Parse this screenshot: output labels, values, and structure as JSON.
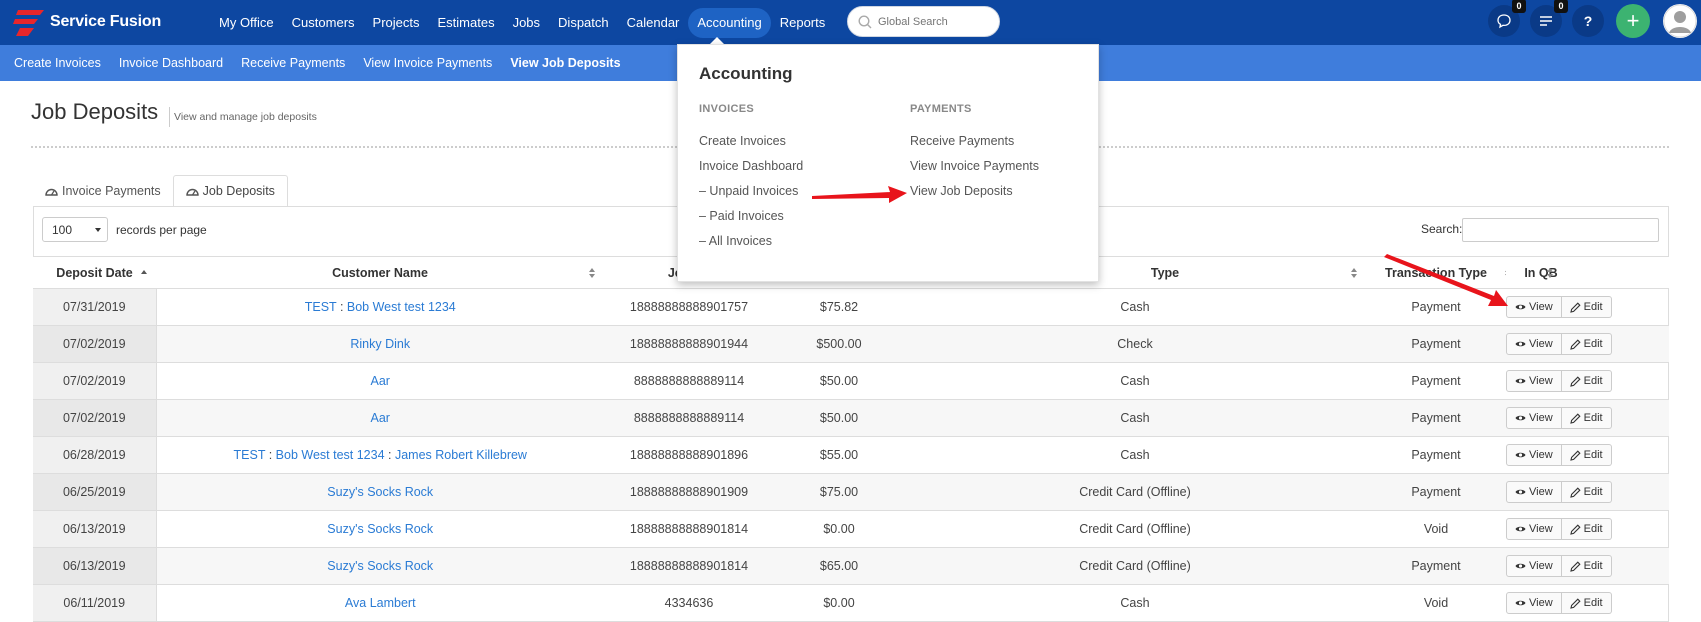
{
  "app": {
    "name": "Service Fusion"
  },
  "nav": {
    "items": [
      "My Office",
      "Customers",
      "Projects",
      "Estimates",
      "Jobs",
      "Dispatch",
      "Calendar",
      "Accounting",
      "Reports"
    ],
    "active": "Accounting",
    "search_placeholder": "Global Search",
    "chat_badge": "0",
    "tasks_badge": "0",
    "help_label": "?",
    "add_label": "+"
  },
  "subnav": {
    "items": [
      "Create Invoices",
      "Invoice Dashboard",
      "Receive Payments",
      "View Invoice Payments",
      "View Job Deposits"
    ],
    "active": "View Job Deposits"
  },
  "page": {
    "title": "Job Deposits",
    "subtitle": "View and manage job deposits"
  },
  "tabs": [
    "Invoice Payments",
    "Job Deposits"
  ],
  "active_tab": "Job Deposits",
  "table_controls": {
    "page_length": "100",
    "page_length_label": "records per page",
    "search_label": "Search:"
  },
  "table": {
    "headers": [
      "Deposit Date",
      "Customer Name",
      "Job Nu",
      "",
      "Type",
      "Transaction Type",
      "In QB",
      ""
    ],
    "view_label": "View",
    "edit_label": "Edit",
    "rows": [
      {
        "date": "07/31/2019",
        "customer_prefix": "TEST",
        "customer": "Bob West test 1234",
        "customer_suffix": "",
        "job": "18888888888901757",
        "amount": "$75.82",
        "type": "Cash",
        "txn": "Payment"
      },
      {
        "date": "07/02/2019",
        "customer_prefix": "",
        "customer": "Rinky Dink",
        "customer_suffix": "",
        "job": "18888888888901944",
        "amount": "$500.00",
        "type": "Check",
        "txn": "Payment"
      },
      {
        "date": "07/02/2019",
        "customer_prefix": "",
        "customer": "Aar",
        "customer_suffix": "",
        "job": "8888888888889114",
        "amount": "$50.00",
        "type": "Cash",
        "txn": "Payment"
      },
      {
        "date": "07/02/2019",
        "customer_prefix": "",
        "customer": "Aar",
        "customer_suffix": "",
        "job": "8888888888889114",
        "amount": "$50.00",
        "type": "Cash",
        "txn": "Payment"
      },
      {
        "date": "06/28/2019",
        "customer_prefix": "TEST",
        "customer": "Bob West test 1234",
        "customer_suffix": "James Robert Killebrew",
        "job": "18888888888901896",
        "amount": "$55.00",
        "type": "Cash",
        "txn": "Payment"
      },
      {
        "date": "06/25/2019",
        "customer_prefix": "",
        "customer": "Suzy's Socks Rock",
        "customer_suffix": "",
        "job": "18888888888901909",
        "amount": "$75.00",
        "type": "Credit Card (Offline)",
        "txn": "Payment"
      },
      {
        "date": "06/13/2019",
        "customer_prefix": "",
        "customer": "Suzy's Socks Rock",
        "customer_suffix": "",
        "job": "18888888888901814",
        "amount": "$0.00",
        "type": "Credit Card (Offline)",
        "txn": "Void"
      },
      {
        "date": "06/13/2019",
        "customer_prefix": "",
        "customer": "Suzy's Socks Rock",
        "customer_suffix": "",
        "job": "18888888888901814",
        "amount": "$65.00",
        "type": "Credit Card (Offline)",
        "txn": "Payment"
      },
      {
        "date": "06/11/2019",
        "customer_prefix": "",
        "customer": "Ava Lambert",
        "customer_suffix": "",
        "job": "4334636",
        "amount": "$0.00",
        "type": "Cash",
        "txn": "Void"
      }
    ]
  },
  "mega_menu": {
    "title": "Accounting",
    "invoices_heading": "INVOICES",
    "invoices": [
      "Create Invoices",
      "Invoice Dashboard",
      "– Unpaid Invoices",
      "– Paid Invoices",
      "– All Invoices"
    ],
    "payments_heading": "PAYMENTS",
    "payments": [
      "Receive Payments",
      "View Invoice Payments",
      "View Job Deposits"
    ]
  },
  "colors": {
    "topbar": "#0d47a1",
    "subbar": "#3f7ddc",
    "link": "#2a7bd4",
    "add_button": "#3cb371",
    "annotation_arrow": "#e8141b"
  },
  "icons": [
    "service-fusion-logo",
    "search-icon",
    "chat-icon",
    "tasks-icon",
    "help-icon",
    "plus-icon",
    "user-avatar-icon",
    "dashboard-icon",
    "eye-icon",
    "pencil-icon",
    "sort-icon"
  ]
}
